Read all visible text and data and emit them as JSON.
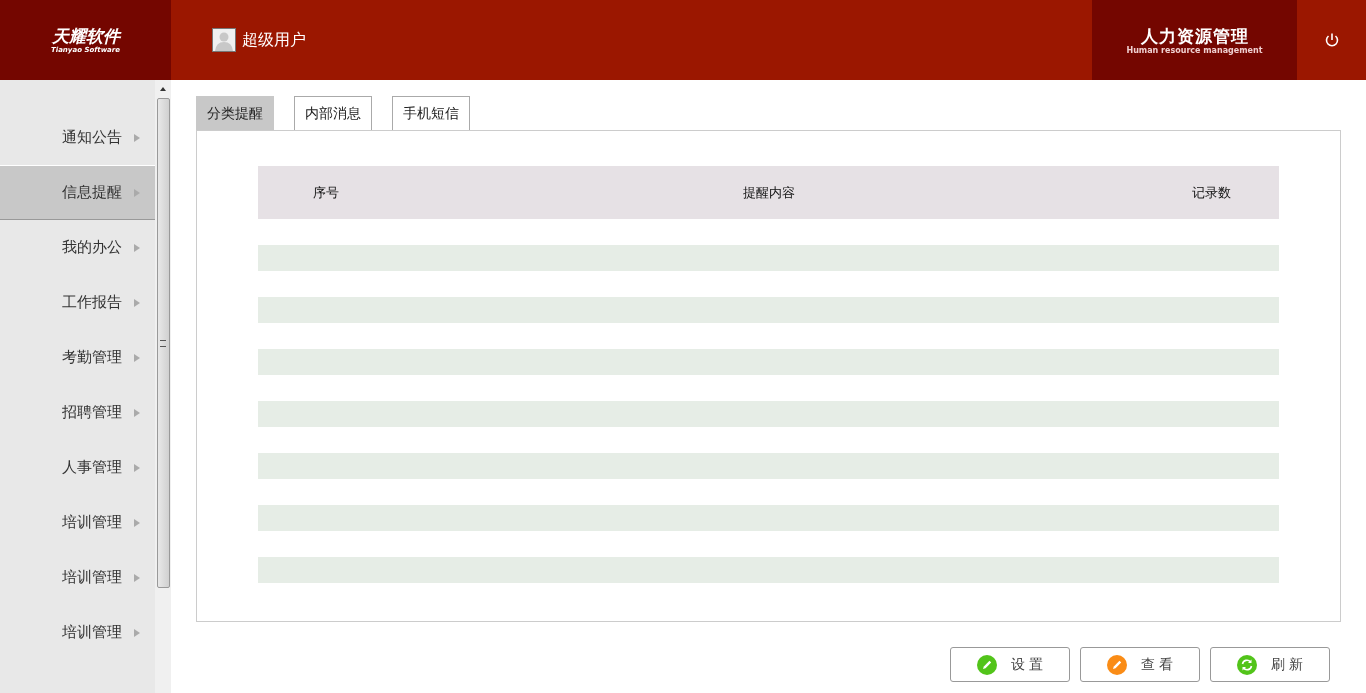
{
  "header": {
    "logo": {
      "title": "天耀软件",
      "subtitle": "Tianyao Software"
    },
    "user": "超级用户",
    "module": {
      "title": "人力资源管理",
      "subtitle": "Human resource management"
    }
  },
  "sidebar": {
    "items": [
      {
        "label": "通知公告",
        "selected": false
      },
      {
        "label": "信息提醒",
        "selected": true
      },
      {
        "label": "我的办公",
        "selected": false
      },
      {
        "label": "工作报告",
        "selected": false
      },
      {
        "label": "考勤管理",
        "selected": false
      },
      {
        "label": "招聘管理",
        "selected": false
      },
      {
        "label": "人事管理",
        "selected": false
      },
      {
        "label": "培训管理",
        "selected": false
      },
      {
        "label": "培训管理",
        "selected": false
      },
      {
        "label": "培训管理",
        "selected": false
      }
    ]
  },
  "tabs": [
    {
      "label": "分类提醒",
      "selected": true
    },
    {
      "label": "内部消息",
      "selected": false
    },
    {
      "label": "手机短信",
      "selected": false
    }
  ],
  "table": {
    "columns": [
      "序号",
      "提醒内容",
      "记录数"
    ]
  },
  "buttons": [
    {
      "label": "设 置",
      "kind": "pencil",
      "color": "#52c41a"
    },
    {
      "label": "查 看",
      "kind": "pencil",
      "color": "#fa8c16"
    },
    {
      "label": "刷 新",
      "kind": "refresh",
      "color": "#52c41a"
    }
  ]
}
